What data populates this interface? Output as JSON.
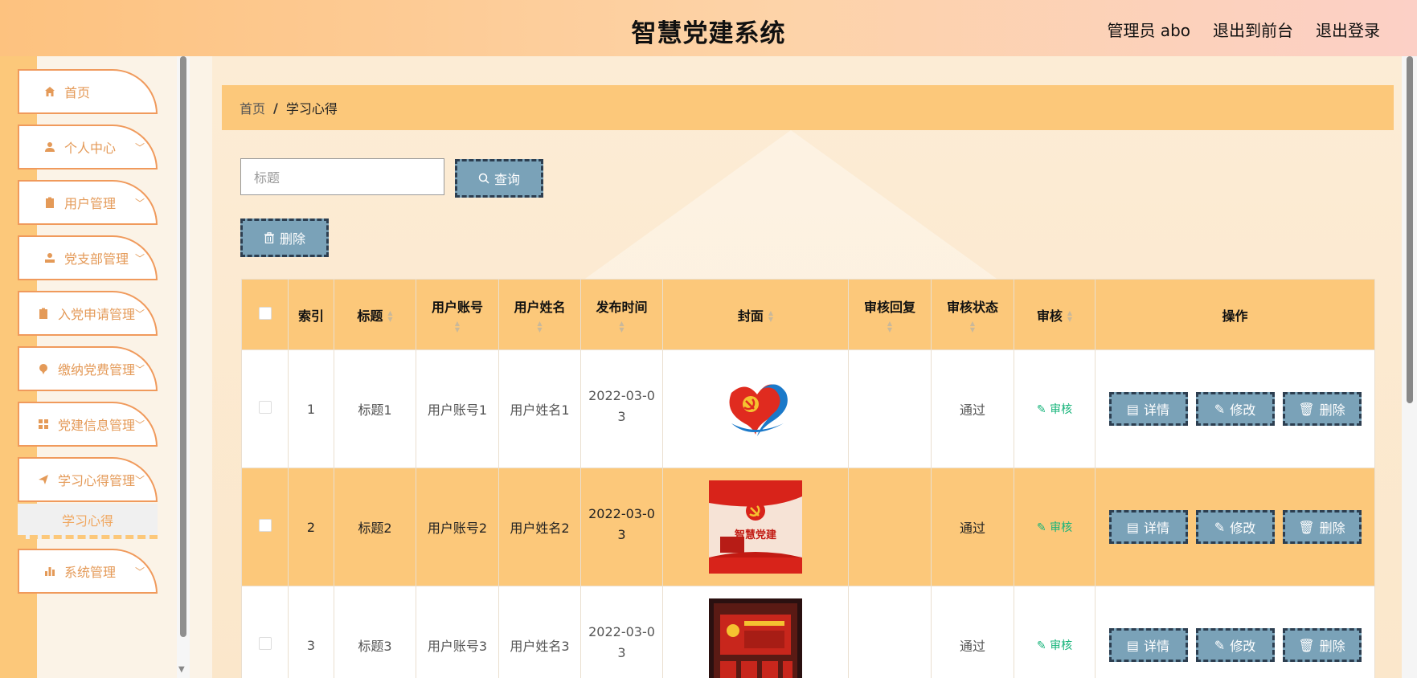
{
  "header": {
    "title": "智慧党建系统",
    "user": "管理员 abo",
    "front_link": "退出到前台",
    "logout": "退出登录"
  },
  "sidebar": {
    "items": [
      {
        "label": "首页",
        "icon": "home-icon"
      },
      {
        "label": "个人中心",
        "icon": "user-icon"
      },
      {
        "label": "用户管理",
        "icon": "clipboard-icon"
      },
      {
        "label": "党支部管理",
        "icon": "person-icon"
      },
      {
        "label": "入党申请管理",
        "icon": "clipboard-icon"
      },
      {
        "label": "缴纳党费管理",
        "icon": "pin-icon"
      },
      {
        "label": "党建信息管理",
        "icon": "grid-icon"
      },
      {
        "label": "学习心得管理",
        "icon": "send-icon"
      },
      {
        "label": "系统管理",
        "icon": "chart-icon"
      }
    ],
    "active_sub": "学习心得"
  },
  "breadcrumb": {
    "home": "首页",
    "sep": "/",
    "current": "学习心得"
  },
  "search": {
    "placeholder": "标题",
    "button": "查询"
  },
  "toolbar": {
    "delete": "删除"
  },
  "table": {
    "headers": [
      "索引",
      "标题",
      "用户账号",
      "用户姓名",
      "发布时间",
      "封面",
      "审核回复",
      "审核状态",
      "审核",
      "操作"
    ],
    "rows": [
      {
        "index": "1",
        "title": "标题1",
        "account": "用户账号1",
        "name": "用户姓名1",
        "date_line1": "2022-03-0",
        "date_line2": "3",
        "reply": "",
        "status": "通过",
        "audit": "审核"
      },
      {
        "index": "2",
        "title": "标题2",
        "account": "用户账号2",
        "name": "用户姓名2",
        "date_line1": "2022-03-0",
        "date_line2": "3",
        "reply": "",
        "status": "通过",
        "audit": "审核"
      },
      {
        "index": "3",
        "title": "标题3",
        "account": "用户账号3",
        "name": "用户姓名3",
        "date_line1": "2022-03-0",
        "date_line2": "3",
        "reply": "",
        "status": "通过",
        "audit": "审核"
      }
    ],
    "actions": {
      "detail": "详情",
      "edit": "修改",
      "delete": "删除"
    },
    "cover_text": "智慧党建"
  }
}
